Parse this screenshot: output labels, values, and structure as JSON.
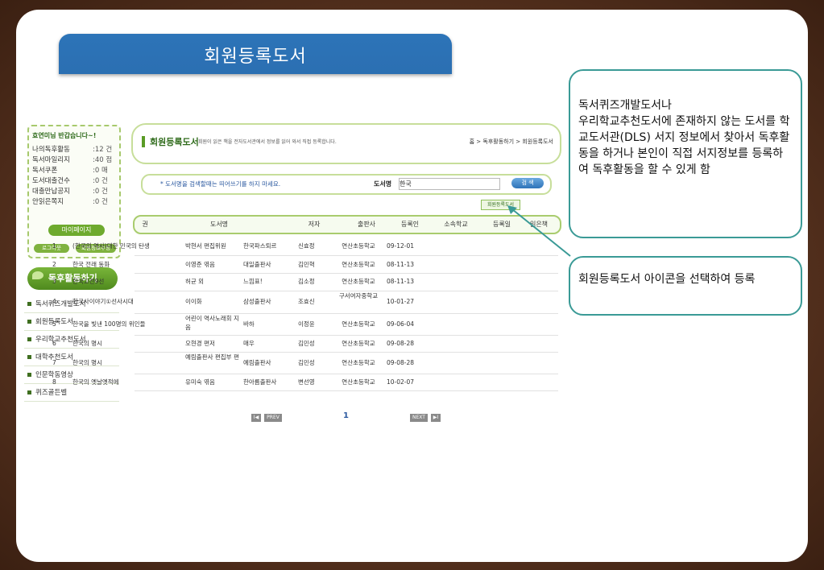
{
  "banner_title": "회원등록도서",
  "sidebar": {
    "greeting": "효연미님 반갑습니다~!",
    "stats": [
      {
        "label": "나의독후활동",
        "value": ":12 건"
      },
      {
        "label": "독서마일리지",
        "value": ":40 점"
      },
      {
        "label": "독서쿠폰",
        "value": ":0 매"
      },
      {
        "label": "도서대출건수",
        "value": ":0 건"
      },
      {
        "label": "대출만납공지",
        "value": ":0 건"
      },
      {
        "label": "안읽은쪽지",
        "value": ":0 건"
      }
    ],
    "mypage_label": "마이페이지",
    "logout_label": "로그아웃",
    "edit_label": "회원정보수정",
    "section_title": "독후활동하기",
    "menu": [
      "독서퀴즈개발도서",
      "회원등록도서",
      "우리학교추천도서",
      "대학추천도서",
      "인문학동영상",
      "퀴즈골든벨"
    ]
  },
  "main": {
    "page_title": "회원등록도서",
    "page_desc": "회원이 읽은 책을 전자도서관에서 정보를 읽어 와서 직접 등록합니다.",
    "breadcrumb": "홈 > 독후활동하기 > 회원등록도서",
    "search_note": "* 도서명을 검색할때는 띄어쓰기를 하지 마세요.",
    "search_label": "도서명",
    "search_value": "한국",
    "search_button": "검 색",
    "register_button": "회원등록도서",
    "columns": [
      "권",
      "도서명",
      "저자",
      "출판사",
      "등록인",
      "소속학교",
      "등록일",
      "읽은책"
    ],
    "rows": [
      [
        "1",
        "(한국의 역사)대한 민국의 탄생",
        "박현서 편집위원",
        "한국파스퇴르",
        "신효정",
        "연산초등학교",
        "09-12-01"
      ],
      [
        "2",
        "한국 전래 동화",
        "이영준 엮음",
        "대일출판사",
        "김민혁",
        "연산초등학교",
        "08-11-13"
      ],
      [
        "3",
        "한국고전9선",
        "허균 외",
        "느낌표!",
        "김소정",
        "연산초등학교",
        "08-11-13"
      ],
      [
        "4",
        "한국사이야기①선사시대",
        "이이화",
        "삼성출판사",
        "조효신",
        "구서여자중학교",
        "10-01-27"
      ],
      [
        "5",
        "한국을 빛낸 100명의 위인들",
        "어린이 역사노래회 지음",
        "바하",
        "이정윤",
        "연산초등학교",
        "09-06-04"
      ],
      [
        "6",
        "한국의 명시",
        "오현경 편저",
        "매우",
        "김민성",
        "연산초등학교",
        "09-08-28"
      ],
      [
        "7",
        "한국의 명시",
        "예림출판사 편집부 편",
        "예림출판사",
        "김민성",
        "연산초등학교",
        "09-08-28"
      ],
      [
        "8",
        "한국의 옛날옛적에",
        "유미숙 엮음",
        "한아름출판사",
        "변선영",
        "연산초등학교",
        "10-02-07"
      ]
    ],
    "pager": {
      "first": "I◀",
      "prev": "PREV",
      "page": "1",
      "next": "NEXT",
      "last": "▶I"
    }
  },
  "callouts": {
    "top": "독서퀴즈개발도서나\n우리학교추천도서에 존재하지 않는 도서를 학교도서관(DLS) 서지 정보에서 찾아서 독후활동을 하거나 본인이 직접 서지정보를 등록하여 독후활동을 할 수 있게 함",
    "bottom": "회원등록도서 아이콘을 선택하여 등록"
  },
  "colors": {
    "banner": "#2d74b8",
    "accent_green": "#5a9b26",
    "callout_border": "#3a9a96",
    "frame": "#5a3420"
  }
}
